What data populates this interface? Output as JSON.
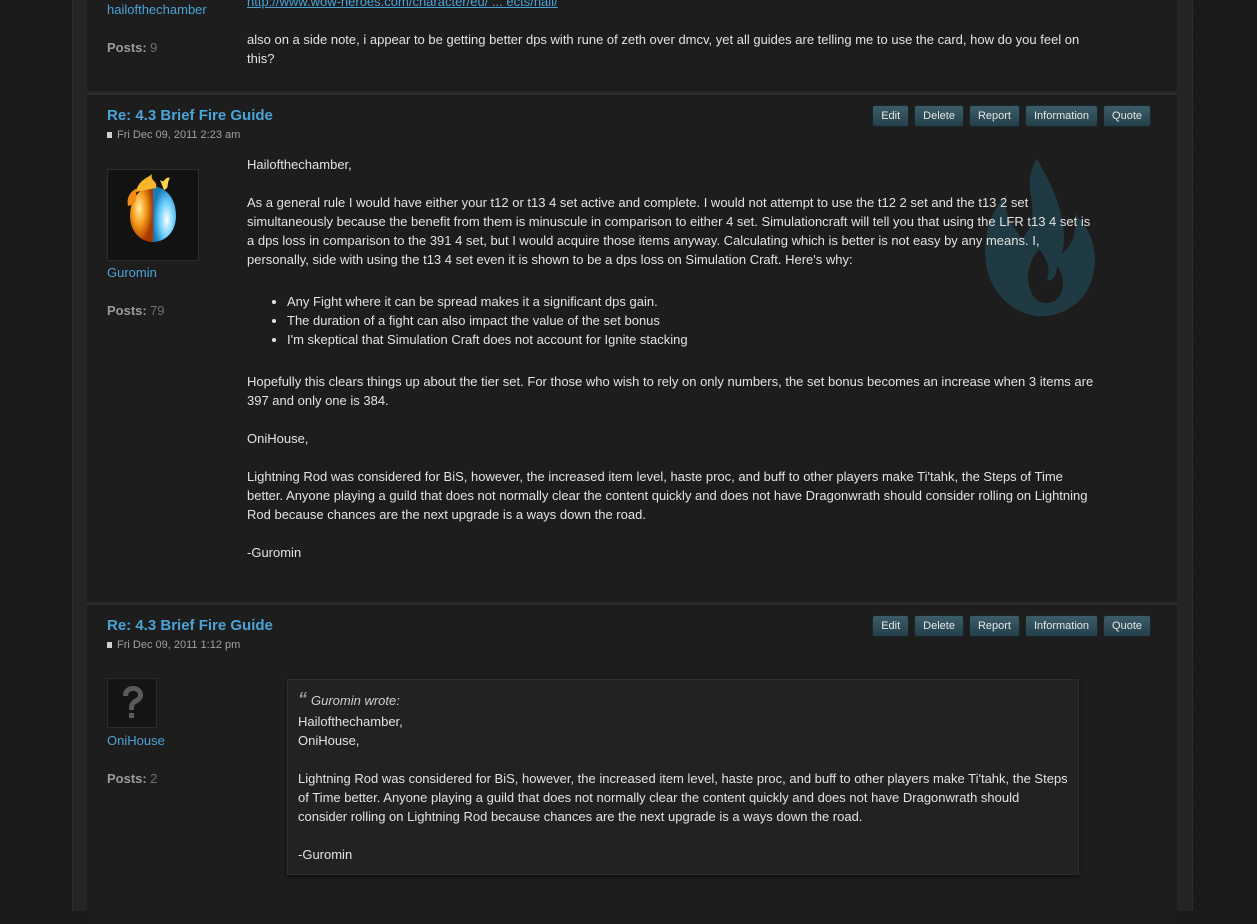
{
  "post_top": {
    "username": "hailofthechamber",
    "posts_label": "Posts:",
    "posts_count": "9",
    "link_text": "http://www.wow-heroes.com/character/eu/ ... ects/hail/",
    "text": "also on a side note, i appear to be getting better dps with rune of zeth over dmcv, yet all guides are telling me to use the card, how do you feel on this?"
  },
  "buttons": {
    "edit": "Edit",
    "delete": "Delete",
    "report": "Report",
    "information": "Information",
    "quote": "Quote"
  },
  "post1": {
    "title": "Re: 4.3 Brief Fire Guide",
    "date": "Fri Dec 09, 2011 2:23 am",
    "username": "Guromin",
    "posts_label": "Posts:",
    "posts_count": "79",
    "p1": "Hailofthechamber,",
    "p2": "As a general rule I would have either your t12 or t13 4 set active and complete. I would not attempt to use the t12 2 set and the t13 2 set simultaneously because the benefit from them is minuscule in comparison to either 4 set. Simulationcraft will tell you that using the LFR t13 4 set is a dps loss in comparison to the 391 4 set, but I would acquire those items anyway. Calculating which is better is not easy by any means. I, personally, side with using the t13 4 set even it is shown to be a dps loss on Simulation Craft. Here's why:",
    "bullets": [
      "Any Fight where it can be spread makes it a significant dps gain.",
      "The duration of a fight can also impact the value of the set bonus",
      "I'm skeptical that Simulation Craft does not account for Ignite stacking"
    ],
    "p3": "Hopefully this clears things up about the tier set. For those who wish to rely on only numbers, the set bonus becomes an increase when 3 items are 397 and only one is 384.",
    "p4": "OniHouse,",
    "p5": "Lightning Rod was considered for BiS, however, the increased item level, haste proc, and buff to other players make Ti'tahk, the Steps of Time better. Anyone playing a guild that does not normally clear the content quickly and does not have Dragonwrath should consider rolling on Lightning Rod because chances are the next upgrade is a ways down the road.",
    "p6": "-Guromin"
  },
  "post2": {
    "title": "Re: 4.3 Brief Fire Guide",
    "date": "Fri Dec 09, 2011 1:12 pm",
    "username": "OniHouse",
    "posts_label": "Posts:",
    "posts_count": "2",
    "quote_author": "Guromin wrote:",
    "q1": "Hailofthechamber,",
    "q2": "OniHouse,",
    "q3": "Lightning Rod was considered for BiS, however, the increased item level, haste proc, and buff to other players make Ti'tahk, the Steps of Time better. Anyone playing a guild that does not normally clear the content quickly and does not have Dragonwrath should consider rolling on Lightning Rod because chances are the next upgrade is a ways down the road.",
    "q4": "-Guromin"
  },
  "colors": {
    "link": "#4aa3d6",
    "button": "#2f4d57",
    "background": "#1d1d1d"
  }
}
